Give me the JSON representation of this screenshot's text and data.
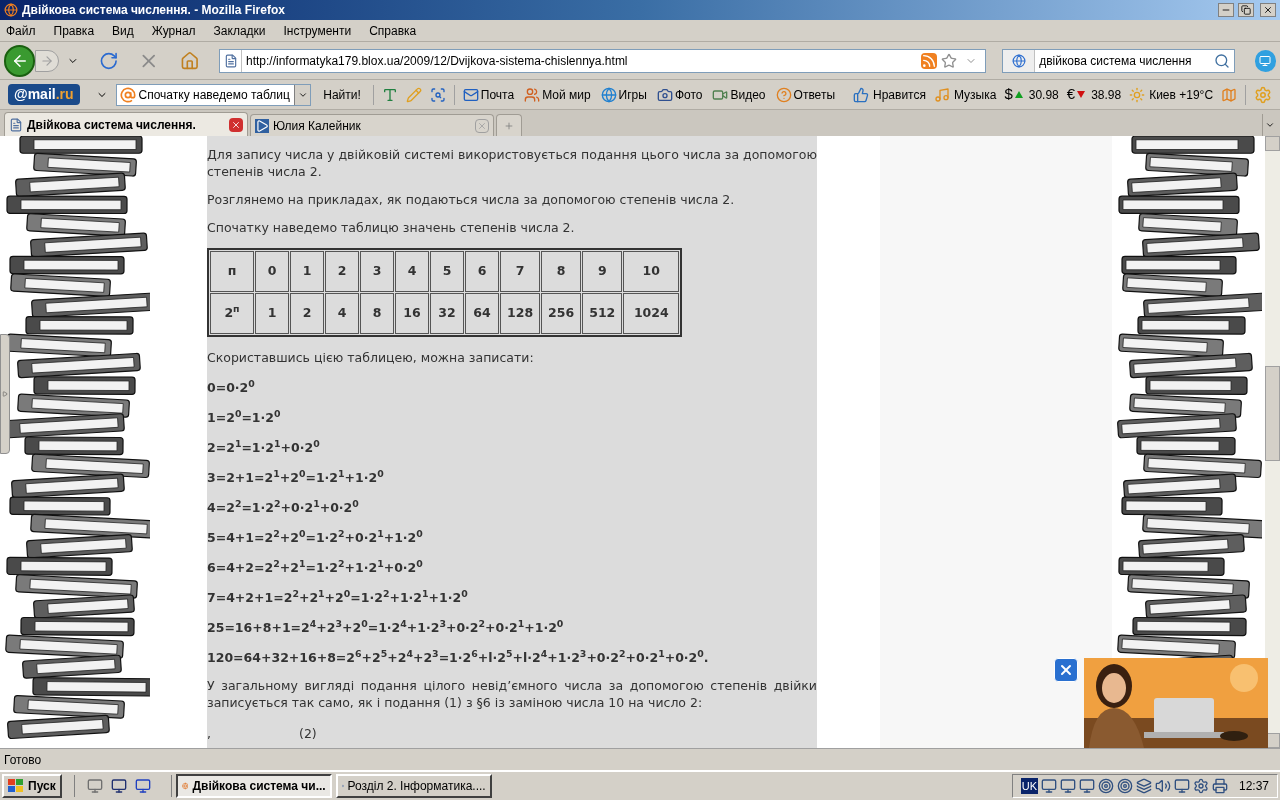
{
  "window": {
    "title": "Двійкова система числення. - Mozilla Firefox"
  },
  "menu": [
    "Файл",
    "Правка",
    "Вид",
    "Журнал",
    "Закладки",
    "Інструменти",
    "Справка"
  ],
  "address": {
    "value": "http://informatyka179.blox.ua/2009/12/Dvijkova-sistema-chislennya.html"
  },
  "search": {
    "value": "двійкова система числення"
  },
  "mail_toolbar": {
    "logo": [
      "@mail",
      ".ru"
    ],
    "search_value": "Спочатку наведемо таблиц",
    "find_button": "Найти!",
    "links": [
      {
        "kind": "mail",
        "label": "Почта"
      },
      {
        "kind": "world",
        "label": "Мой мир"
      },
      {
        "kind": "games",
        "label": "Игры"
      },
      {
        "label": "Фото"
      },
      {
        "kind": "video",
        "label": "Видео"
      },
      {
        "kind": "answers",
        "label": "Ответы"
      }
    ],
    "widgets": [
      {
        "kind": "like",
        "label": "Нравится"
      },
      {
        "kind": "music",
        "label": "Музыка"
      },
      {
        "kind": "rate",
        "symbol": "$",
        "rising": true,
        "value": "30.98"
      },
      {
        "kind": "rate",
        "symbol": "€",
        "rising": false,
        "value": "38.98"
      },
      {
        "kind": "weather",
        "label": "Киев +19°C"
      }
    ]
  },
  "tabs": [
    {
      "label": "Двійкова система числення.",
      "selected": true
    },
    {
      "label": "Юлия Калейник",
      "selected": false
    }
  ],
  "article": {
    "paragraphs_top": [
      "Для запису числа у двійковій системі використовується подання цього числа за допомогою степенів числа 2.",
      "Розглянемо на прикладах, як подаються числа за допомогою степенів числа 2.",
      "Спочатку наведемо таблицю значень степенів числа 2."
    ],
    "table": [
      [
        "п",
        "0",
        "1",
        "2",
        "3",
        "4",
        "5",
        "6",
        "7",
        "8",
        "9",
        "10"
      ],
      [
        "2$^{п}$",
        "1",
        "2",
        "4",
        "8",
        "16",
        "32",
        "64",
        "128",
        "256",
        "512",
        "1024"
      ]
    ],
    "intro": "Скориставшись цією таблицею, можна записати:",
    "formulas": [
      "0=0·2$^{0}$",
      "1=2$^{0}$=1·2$^{0}$",
      "2=2$^{1}$=1·2$^{1}$+0·2$^{0}$",
      "3=2+1=2$^{1}$+2$^{0}$=1·2$^{1}$+1·2$^{0}$",
      "4=2$^{2}$=1·2$^{2}$+0·2$^{1}$+0·2$^{0}$",
      "5=4+1=2$^{2}$+2$^{0}$=1·2$^{2}$+0·2$^{1}$+1·2$^{0}$",
      "6=4+2=2$^{2}$+2$^{1}$=1·2$^{2}$+1·2$^{1}$+0·2$^{0}$",
      "7=4+2+1=2$^{2}$+2$^{1}$+2$^{0}$=1·2$^{2}$+1·2$^{1}$+1·2$^{0}$",
      "25=16+8+1=2$^{4}$+2$^{3}$+2$^{0}$=1·2$^{4}$+1·2$^{3}$+0·2$^{2}$+0·2$^{1}$+1·2$^{0}$",
      "120=64+32+16+8=2$^{6}$+2$^{5}$+2$^{4}$+2$^{3}$=1·2$^{6}$+l·2$^{5}$+l·2$^{4}$+1·2$^{3}$+0·2$^{2}$+0·2$^{1}$+0·2$^{0}$."
    ],
    "paragraph_bottom": "У загальному вигляді подання цілого невід’ємного числа за допомогою степенів двійки записується так само, як і подання (1) з §6 із заміною числа 10 на число 2:",
    "last_line": [
      ",",
      "(2)"
    ]
  },
  "status_bar": "Готово",
  "taskbar": {
    "start": "Пуск",
    "tasks": [
      {
        "label": "Двійкова система чи...",
        "selected": true
      },
      {
        "label": "Розділ 2. Інформатика....",
        "selected": false
      }
    ],
    "language": "UK",
    "clock": "12:37"
  }
}
